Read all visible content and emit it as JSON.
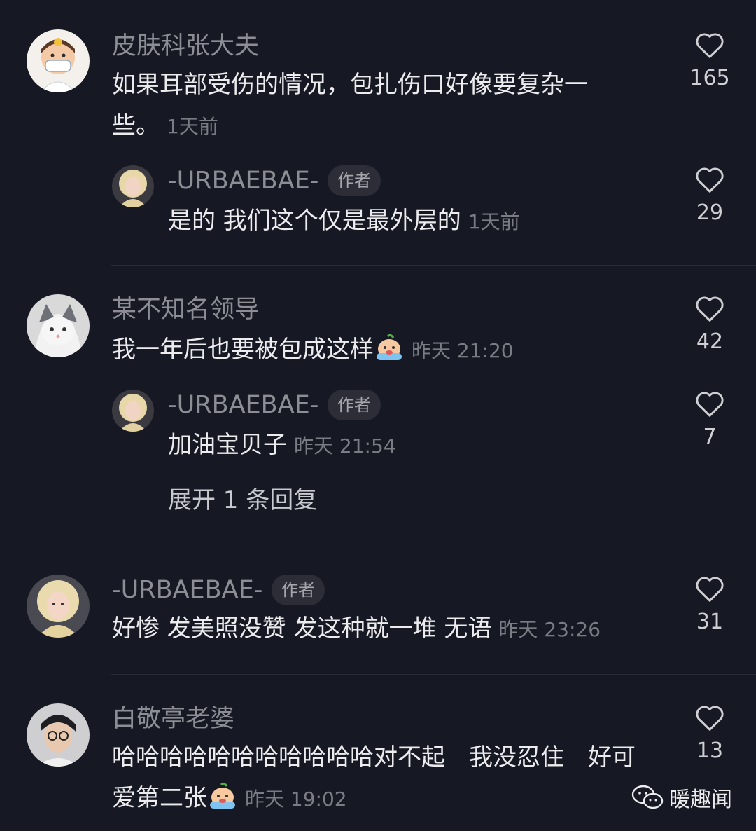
{
  "colors": {
    "background": "#161823",
    "username": "#8D8E95",
    "text": "#ECECEE",
    "muted": "#7B7C83"
  },
  "comments": [
    {
      "username": "皮肤科张大夫",
      "text": "如果耳部受伤的情况，包扎伤口好像要复杂一些。",
      "time": "1天前",
      "likes": "165",
      "reply": {
        "username": "-URBAEBAE-",
        "badge": "作者",
        "text": "是的 我们这个仅是最外层的",
        "time": "1天前",
        "likes": "29"
      }
    },
    {
      "username": "某不知名领导",
      "text": "我一年后也要被包成这样",
      "time": "昨天 21:20",
      "likes": "42",
      "reply": {
        "username": "-URBAEBAE-",
        "badge": "作者",
        "text": "加油宝贝子",
        "time": "昨天 21:54",
        "likes": "7"
      },
      "expand": "展开 1 条回复"
    },
    {
      "username": "-URBAEBAE-",
      "badge": "作者",
      "text": "好惨 发美照没赞 发这种就一堆 无语",
      "time": "昨天 23:26",
      "likes": "31"
    },
    {
      "username": "白敬亭老婆",
      "text": "哈哈哈哈哈哈哈哈哈哈哈对不起　我没忍住　好可爱第二张",
      "time": "昨天 19:02",
      "likes": "13"
    }
  ],
  "watermark": {
    "icon": "wechat-icon",
    "text": "暖趣闻"
  }
}
